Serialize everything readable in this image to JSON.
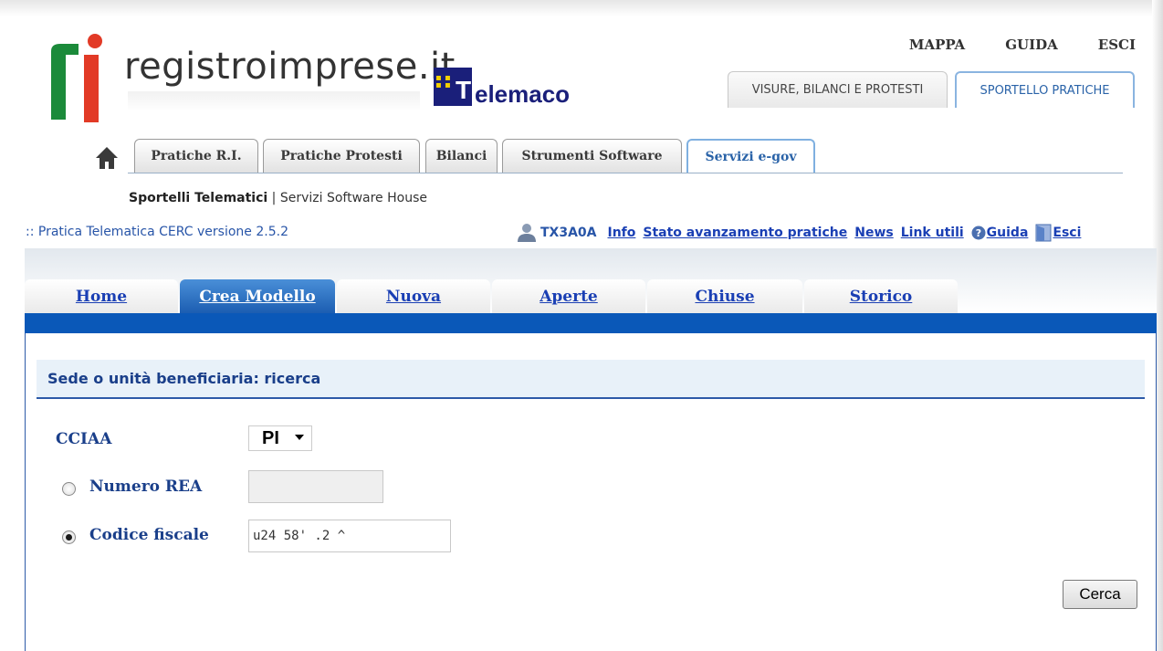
{
  "brand": {
    "name": "registroimprese.it",
    "partner": "elemaco"
  },
  "top_links": [
    "MAPPA",
    "GUIDA",
    "ESCI"
  ],
  "top_tabs": {
    "visure": "VISURE, BILANCI E PROTESTI",
    "sportello": "SPORTELLO PRATICHE"
  },
  "main_tabs": [
    "Pratiche R.I.",
    "Pratiche Protesti",
    "Bilanci",
    "Strumenti Software",
    "Servizi e-gov"
  ],
  "subnav": {
    "active": "Sportelli Telematici",
    "separator": " | ",
    "other": "Servizi Software House"
  },
  "app_line": ":: Pratica Telematica CERC versione 2.5.2",
  "user": {
    "id": "TX3A0A",
    "links": [
      "Info",
      "Stato avanzamento pratiche",
      "News",
      "Link utili",
      "Guida",
      "Esci"
    ]
  },
  "page_tabs": [
    "Home",
    "Crea Modello",
    "Nuova",
    "Aperte",
    "Chiuse",
    "Storico"
  ],
  "section_title": "Sede o unità beneficiaria: ricerca",
  "form": {
    "cciaa_label": "CCIAA",
    "cciaa_value": "PI",
    "rea_label": "Numero REA",
    "rea_value": "",
    "cf_label": "Codice fiscale",
    "cf_value": "u24  58' .2   ^",
    "selected": "Codice fiscale"
  },
  "search_button": "Cerca",
  "colors": {
    "link": "#1a3fb4",
    "accent": "#0a58b8",
    "label": "#1a3f8a"
  }
}
